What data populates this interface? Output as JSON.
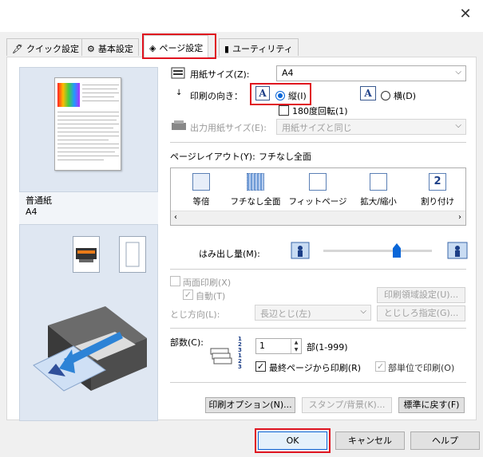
{
  "titlebar": {
    "close_label": "✕"
  },
  "tabs": [
    {
      "label": "クイック設定",
      "icon": "quick-setup-icon"
    },
    {
      "label": "基本設定",
      "icon": "main-settings-icon"
    },
    {
      "label": "ページ設定",
      "icon": "page-setup-icon"
    },
    {
      "label": "ユーティリティ",
      "icon": "utility-icon"
    }
  ],
  "preview": {
    "media_type": "普通紙",
    "paper_size": "A4"
  },
  "page": {
    "paper_size_label": "用紙サイズ(Z):",
    "paper_size_value": "A4",
    "orientation_label": "印刷の向き：",
    "portrait_label": "縦(I)",
    "landscape_label": "横(D)",
    "rotate_label": "180度回転(1)",
    "output_size_label": "出力用紙サイズ(E):",
    "output_size_value": "用紙サイズと同じ",
    "layout_label": "ページレイアウト(Y):",
    "layout_value": "フチなし全面",
    "layouts": [
      "等倍",
      "フチなし全面",
      "フィットページ",
      "拡大/縮小",
      "割り付け"
    ],
    "extension_label": "はみ出し量(M):",
    "duplex_label": "両面印刷(X)",
    "auto_label": "自動(T)",
    "print_area_button": "印刷領域設定(U)...",
    "binding_label": "とじ方向(L):",
    "binding_value": "長辺とじ(左)",
    "margin_button": "とじしろ指定(G)...",
    "copies_label": "部数(C):",
    "copies_value": "1",
    "copies_range": "部(1-999)",
    "last_page_label": "最終ページから印刷(R)",
    "collate_label": "部単位で印刷(O)",
    "print_options_button": "印刷オプション(N)...",
    "stamp_button": "スタンプ/背景(K)...",
    "defaults_button": "標準に戻す(F)"
  },
  "dialog": {
    "ok_label": "OK",
    "cancel_label": "キャンセル",
    "help_label": "ヘルプ"
  },
  "colors": {
    "highlight": "#e0131f",
    "accent": "#0a66d8"
  }
}
